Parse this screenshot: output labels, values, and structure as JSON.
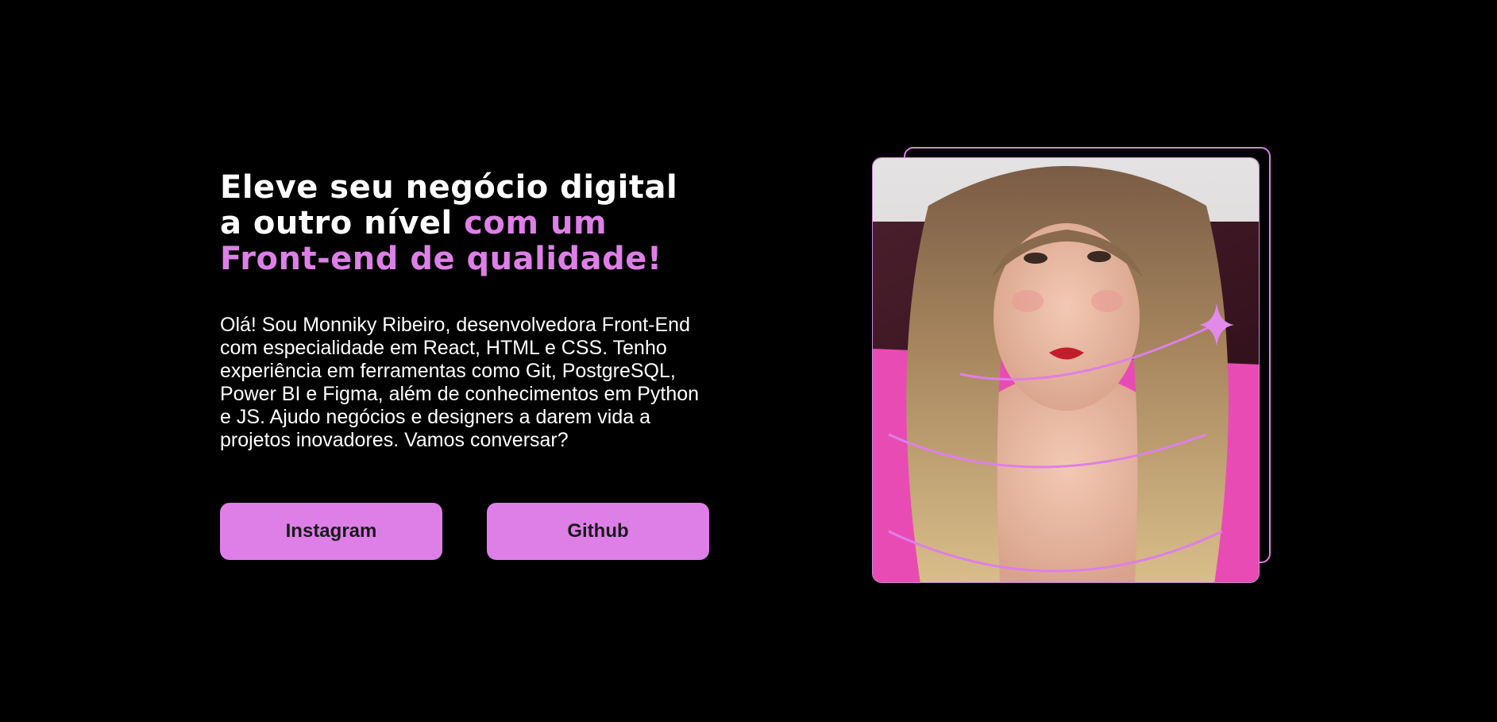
{
  "hero": {
    "headline_white_1": "Eleve seu negócio digital",
    "headline_white_2": "a outro nível",
    "headline_accent_1": "com um",
    "headline_accent_2": "Front-end de qualidade!",
    "intro": "Olá! Sou Monniky Ribeiro, desenvolvedora Front-End com especialidade em React, HTML e CSS. Tenho experiência em ferramentas como Git, PostgreSQL, Power BI e Figma, além de conhecimentos em Python e JS. Ajudo negócios e designers a darem vida a projetos inovadores. Vamos conversar?"
  },
  "buttons": {
    "instagram_label": "Instagram",
    "github_label": "Github"
  },
  "colors": {
    "background": "#000000",
    "accent": "#de7fe8",
    "text": "#ffffff"
  },
  "icons": {
    "sparkle": "sparkle-icon"
  }
}
